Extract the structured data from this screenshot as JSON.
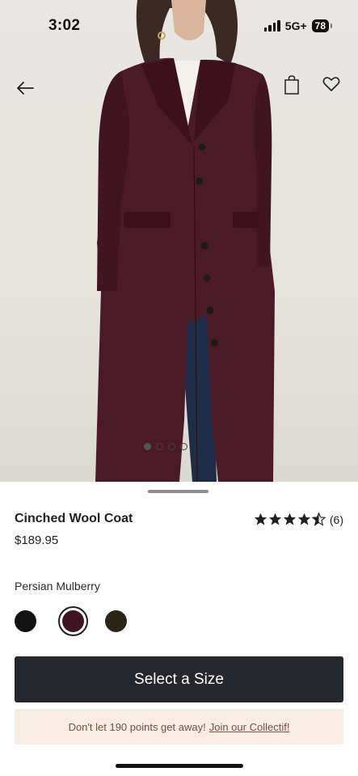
{
  "status_bar": {
    "time": "3:02",
    "network": "5G+",
    "battery": "78"
  },
  "hero": {
    "image_subject": "coat-photo",
    "carousel_active_index": 0,
    "carousel_count": 4
  },
  "product": {
    "title": "Cinched Wool Coat",
    "price": "$189.95",
    "rating": 4.5,
    "review_count": "(6)",
    "color_name": "Persian Mulberry",
    "swatches": [
      {
        "name": "black",
        "color": "#111214",
        "selected": false
      },
      {
        "name": "persian-mulberry",
        "color": "#3f1421",
        "selected": true
      },
      {
        "name": "olive",
        "color": "#2b2516",
        "selected": false
      }
    ]
  },
  "actions": {
    "select_size_label": "Select a Size"
  },
  "promo": {
    "text": "Don't let 190 points get away!",
    "link": "Join our Collectif!"
  },
  "colors": {
    "cta_bg": "#26262d",
    "promo_bg": "#f8ede3",
    "coat": "#4a1a26"
  }
}
